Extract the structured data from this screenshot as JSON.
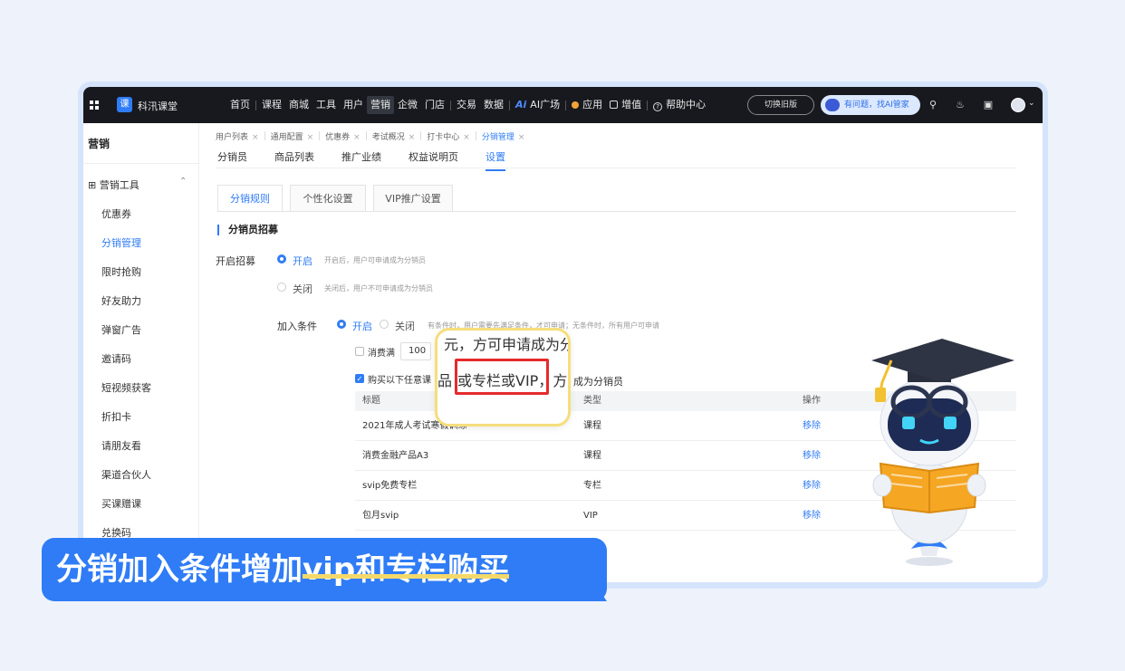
{
  "topbar": {
    "brand": "科汛课堂",
    "nav": [
      "首页",
      "课程",
      "商城",
      "工具",
      "用户",
      "营销",
      "企微",
      "门店",
      "交易",
      "数据"
    ],
    "active_nav": "营销",
    "ai_plaza": "AI广场",
    "ai_mark": "Ai",
    "apps": "应用",
    "value_added": "增值",
    "help": "帮助中心",
    "switch_old": "切换旧版",
    "ai_help": "有问题，找AI管家"
  },
  "sidebar": {
    "title": "营销",
    "group": "营销工具",
    "items": [
      "优惠券",
      "分销管理",
      "限时抢购",
      "好友助力",
      "弹窗广告",
      "邀请码",
      "短视频获客",
      "折扣卡",
      "请朋友看",
      "渠道合伙人",
      "买课赠课",
      "兑换码"
    ],
    "active_item": "分销管理"
  },
  "breadcrumbs": [
    "用户列表",
    "通用配置",
    "优惠券",
    "考试概况",
    "打卡中心",
    "分销管理"
  ],
  "subtabs": [
    "分销员",
    "商品列表",
    "推广业绩",
    "权益说明页",
    "设置"
  ],
  "active_subtab": "设置",
  "card_tabs": [
    "分销规则",
    "个性化设置",
    "VIP推广设置"
  ],
  "section_title": "分销员招募",
  "recruit": {
    "label": "开启招募",
    "on": "开启",
    "on_hint": "开启后，用户可申请成为分销员",
    "off": "关闭",
    "off_hint": "关闭后，用户不可申请成为分销员"
  },
  "join": {
    "label": "加入条件",
    "on": "开启",
    "off": "关闭",
    "hint": "有条件时，用户需要先满足条件，才可申请；无条件时，所有用户可申请",
    "spend_label": "消费满",
    "spend_value": "100",
    "buy_label": "购买以下任意课",
    "buy_suffix": "成为分销员"
  },
  "table": {
    "headers": [
      "标题",
      "类型",
      "操作"
    ],
    "rows": [
      {
        "title": "2021年成人考试寒假训练",
        "type": "课程",
        "action": "移除"
      },
      {
        "title": "消费金融产品A3",
        "type": "课程",
        "action": "移除"
      },
      {
        "title": "svip免费专栏",
        "type": "专栏",
        "action": "移除"
      },
      {
        "title": "包月svip",
        "type": "VIP",
        "action": "移除"
      }
    ]
  },
  "zoom": {
    "line1": "元，方可申请成为分",
    "line2_pre": "品",
    "line2_box": "或专栏或VIP，",
    "line2_post": "方可"
  },
  "caption": {
    "pre": "分销加入条件增加",
    "highlight": "vip和专栏购买"
  },
  "colors": {
    "accent": "#2f7cf6",
    "topbar": "#17191f",
    "highlight_box": "#e52b2b",
    "zoom_border": "#f6de7c",
    "caption_underline": "#f4d96a"
  }
}
